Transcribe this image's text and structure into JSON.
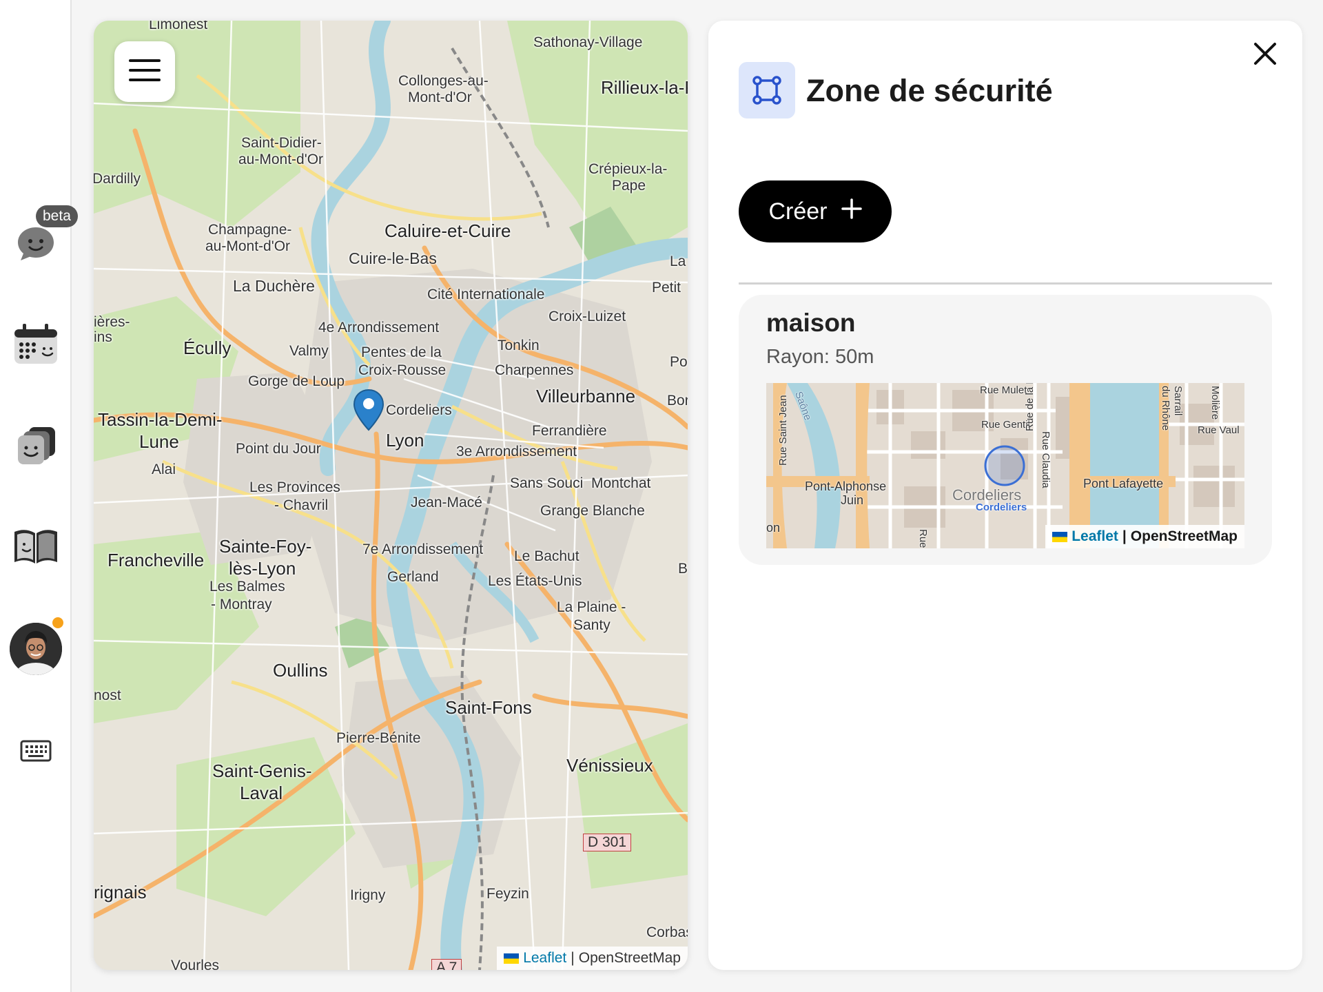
{
  "rail": {
    "beta_label": "beta",
    "items": [
      {
        "icon": "chat-bubble-smile-icon"
      },
      {
        "icon": "calendar-smile-icon"
      },
      {
        "icon": "stacked-cards-icon"
      },
      {
        "icon": "open-book-icon"
      },
      {
        "icon": "user-avatar"
      },
      {
        "icon": "keyboard-icon"
      }
    ],
    "notification_color": "#f7a21b"
  },
  "map": {
    "menu_icon": "hamburger-menu-icon",
    "marker_color": "#2a81cb",
    "attribution": {
      "leaflet": "Leaflet",
      "separator": "|",
      "osm": "OpenStreetMap"
    },
    "place_labels": [
      "Limonest",
      "Sathonay-Village",
      "Collonges-au-",
      "Mont-d'Or",
      "Rillieux-la-P",
      "Saint-Didier-",
      "au-Mont-d'Or",
      "Dardilly",
      "Crépieux-la-",
      "Pape",
      "Champagne-",
      "au-Mont-d'Or",
      "Caluire-et-Cuire",
      "Cuire-le-Bas",
      "La Duchère",
      "Cité Internationale",
      "La",
      "Petit",
      "Croix-Luizet",
      "4e Arrondissement",
      "Écully",
      "Valmy",
      "Pentes de la",
      "Croix-Rousse",
      "Tonkin",
      "Charpennes",
      "Gorge de Loup",
      "Villeurbanne",
      "Cordeliers",
      "Tassin-la-Demi-",
      "Lune",
      "Lyon",
      "Ferrandière",
      "Point du Jour",
      "3e Arrondissement",
      "Alai",
      "Les Provinces",
      "- Chavril",
      "Sans Souci",
      "Montchat",
      "Jean-Macé",
      "Grange Blanche",
      "Francheville",
      "Sainte-Foy-",
      "lès-Lyon",
      "7e Arrondissement",
      "Le Bachut",
      "Les Balmes",
      "- Montray",
      "Gerland",
      "Les États-Unis",
      "La Plaine -",
      "Santy",
      "Oullins",
      "nost",
      "Saint-Fons",
      "Pierre-Bénite",
      "Vénissieux",
      "Saint-Genis-",
      "Laval",
      "D 301",
      "rignais",
      "Irigny",
      "Feyzin",
      "Corbas",
      "Vourles",
      "A 7",
      "ières-",
      "ins",
      "Po",
      "Bor",
      "B"
    ]
  },
  "panel": {
    "close_icon": "close-x-icon",
    "title_icon": "zone-bounding-box-icon",
    "title": "Zone de sécurité",
    "create_label": "Créer",
    "create_icon": "plus-icon",
    "accent_color": "#dde6fb",
    "zones": [
      {
        "name": "maison",
        "radius_label": "Rayon: 50m",
        "mini_map": {
          "labels": [
            "Rue Mulet",
            "Rue Gentil",
            "Rue de la Bourse",
            "Rue Claudia",
            "Rue Vaul",
            "Molière",
            "Sarrail",
            "du Rhône",
            "Pont-Alphonse",
            "Juin",
            "Cordeliers",
            "Cordeliers",
            "Pont Lafayette",
            "Rue",
            "Rue Saint Jean",
            "on",
            "Saône"
          ],
          "attribution_leaflet": "Leaflet",
          "attribution_separator": "|",
          "attribution_osm": "OpenStreetMap"
        }
      }
    ]
  }
}
